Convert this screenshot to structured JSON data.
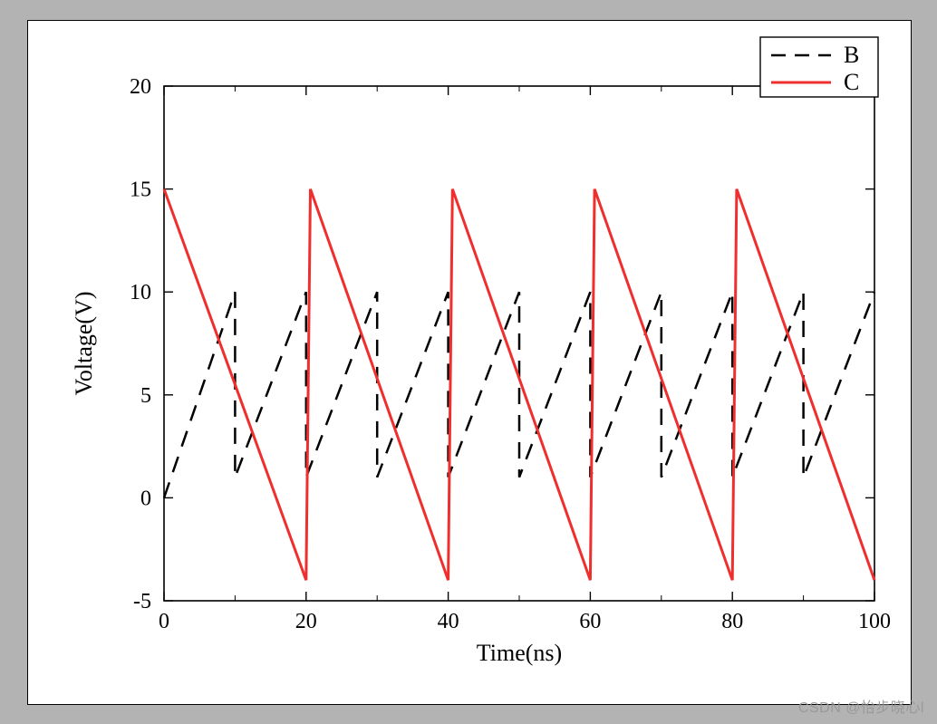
{
  "chart_data": {
    "type": "line",
    "title": "",
    "xlabel": "Time(ns)",
    "ylabel": "Voltage(V)",
    "xlim": [
      0,
      100
    ],
    "ylim": [
      -5,
      20
    ],
    "xticks": [
      0,
      20,
      40,
      60,
      80,
      100
    ],
    "yticks": [
      -5,
      0,
      5,
      10,
      15,
      20
    ],
    "xminor": [
      10,
      30,
      50,
      70,
      90
    ],
    "grid": false,
    "legend": {
      "position": "top-right",
      "border": true
    },
    "series": [
      {
        "name": "B",
        "color": "#000000",
        "style": "dashed",
        "width": 2.5,
        "x": [
          0,
          10,
          10,
          20,
          20,
          30,
          30,
          40,
          40,
          50,
          50,
          60,
          60,
          70,
          70,
          80,
          80,
          90,
          90,
          100
        ],
        "values": [
          0,
          10,
          1,
          10,
          1,
          10,
          1,
          10,
          1,
          10,
          1,
          10,
          1,
          10,
          1,
          10,
          1,
          10,
          1,
          10
        ]
      },
      {
        "name": "C",
        "color": "#ef2e2e",
        "style": "solid",
        "width": 3,
        "x": [
          0,
          20,
          20.6,
          40,
          40.6,
          60,
          60.6,
          80,
          80.6,
          100
        ],
        "values": [
          15,
          -4,
          15,
          -4,
          15,
          -4,
          15,
          -4,
          15,
          -4
        ]
      }
    ]
  },
  "watermark": "CSDN @怡步晓心l"
}
